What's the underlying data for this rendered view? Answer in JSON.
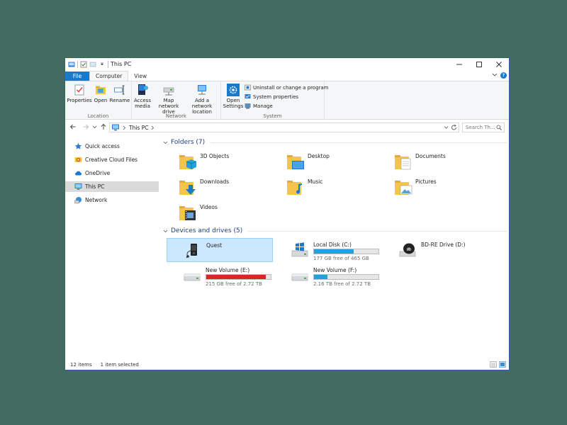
{
  "window": {
    "title": "This PC"
  },
  "ribbon_tabs": [
    {
      "label": "File"
    },
    {
      "label": "Computer"
    },
    {
      "label": "View"
    }
  ],
  "help_label": "?",
  "ribbon": {
    "location": {
      "label": "Location",
      "properties": "Properties",
      "open": "Open",
      "rename": "Rename"
    },
    "network": {
      "label": "Network",
      "access_media": "Access media",
      "map_network_drive": "Map network drive",
      "add_network_location": "Add a network location"
    },
    "system": {
      "label": "System",
      "open_settings": "Open Settings",
      "uninstall": "Uninstall or change a program",
      "system_properties": "System properties",
      "manage": "Manage"
    }
  },
  "address": {
    "path": [
      "This PC"
    ],
    "search_placeholder": "Search Th..."
  },
  "nav_pane": [
    {
      "label": "Quick access",
      "icon": "star-icon"
    },
    {
      "label": "Creative Cloud Files",
      "icon": "creative-cloud-icon"
    },
    {
      "label": "OneDrive",
      "icon": "cloud-icon"
    },
    {
      "label": "This PC",
      "icon": "computer-icon",
      "selected": true
    },
    {
      "label": "Network",
      "icon": "network-icon"
    }
  ],
  "folders": {
    "header": "Folders (7)",
    "items": [
      {
        "label": "3D Objects",
        "icon": "3d-objects-folder-icon"
      },
      {
        "label": "Desktop",
        "icon": "desktop-folder-icon"
      },
      {
        "label": "Documents",
        "icon": "documents-folder-icon"
      },
      {
        "label": "Downloads",
        "icon": "downloads-folder-icon"
      },
      {
        "label": "Music",
        "icon": "music-folder-icon"
      },
      {
        "label": "Pictures",
        "icon": "pictures-folder-icon"
      },
      {
        "label": "Videos",
        "icon": "videos-folder-icon"
      }
    ]
  },
  "devices": {
    "header": "Devices and drives (5)",
    "items": [
      {
        "label": "Quest",
        "icon": "media-player-icon",
        "selected": true
      },
      {
        "label": "Local Disk (C:)",
        "icon": "windows-drive-icon",
        "free": "177 GB free of 465 GB",
        "used_fraction": 0.62,
        "color": "#26a0da"
      },
      {
        "label": "BD-RE Drive (D:)",
        "icon": "bluray-drive-icon"
      },
      {
        "label": "New Volume (E:)",
        "icon": "hard-drive-icon",
        "free": "215 GB free of 2.72 TB",
        "used_fraction": 0.92,
        "color": "#da2626"
      },
      {
        "label": "New Volume (F:)",
        "icon": "hard-drive-icon",
        "free": "2.16 TB free of 2.72 TB",
        "used_fraction": 0.21,
        "color": "#26a0da"
      }
    ]
  },
  "status": {
    "items": "12 items",
    "selected": "1 item selected"
  },
  "colors": {
    "accent": "#1979ca",
    "selection": "#cce8ff",
    "drive_ok": "#26a0da",
    "drive_full": "#da2626"
  }
}
